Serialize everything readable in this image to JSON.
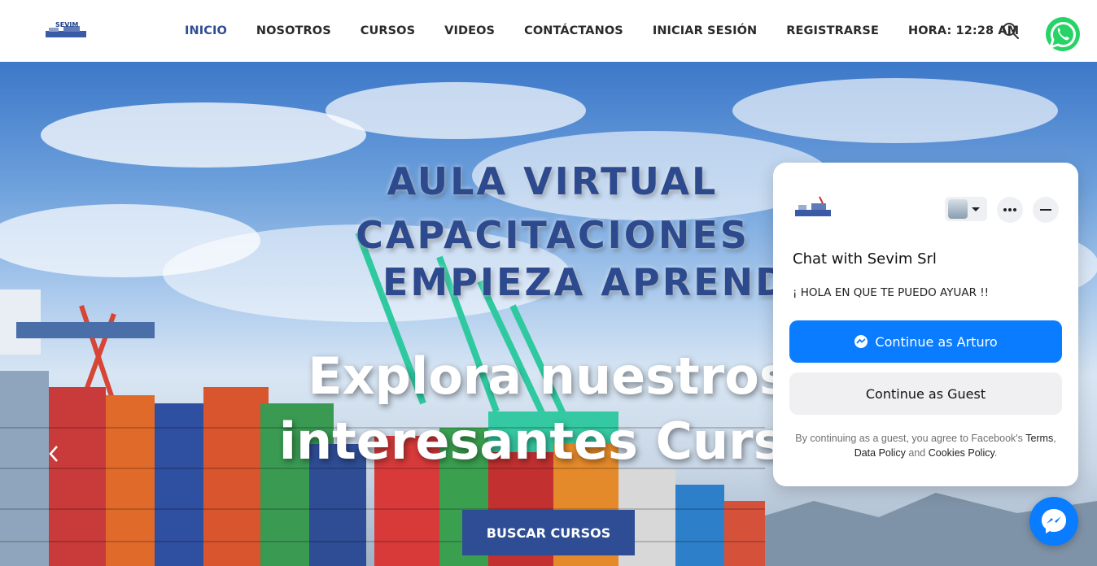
{
  "header": {
    "logo_text": "SEVIM",
    "nav": [
      {
        "label": "INICIO",
        "active": true
      },
      {
        "label": "NOSOTROS",
        "active": false
      },
      {
        "label": "CURSOS",
        "active": false
      },
      {
        "label": "VIDEOS",
        "active": false
      },
      {
        "label": "CONTÁCTANOS",
        "active": false
      },
      {
        "label": "INICIAR SESIÓN",
        "active": false
      },
      {
        "label": "REGISTRARSE",
        "active": false
      },
      {
        "label": "HORA: 12:28 AM",
        "active": false
      }
    ],
    "search_icon": "search-icon",
    "whatsapp_icon": "whatsapp-icon"
  },
  "hero": {
    "line1": "AULA VIRTUAL",
    "line2": "CAPACITACIONES",
    "line3": "EMPIEZA APRENDER H",
    "explore1": "Explora nuestros",
    "explore2": "interesantes Curso",
    "cta": "BUSCAR CURSOS"
  },
  "chat": {
    "title": "Chat with Sevim Srl",
    "greeting": "¡ HOLA EN QUE TE PUEDO AYUAR !!",
    "continue_user": "Continue as Arturo",
    "continue_guest": "Continue as Guest",
    "terms_prefix": "By continuing as a guest, you agree to Facebook's",
    "terms_link": "Terms",
    "data_policy": "Data Policy",
    "and": "and",
    "cookies_policy": "Cookies Policy"
  },
  "colors": {
    "accent": "#2f4d92",
    "messenger_blue": "#0a7cff",
    "whatsapp_green": "#25d366"
  }
}
